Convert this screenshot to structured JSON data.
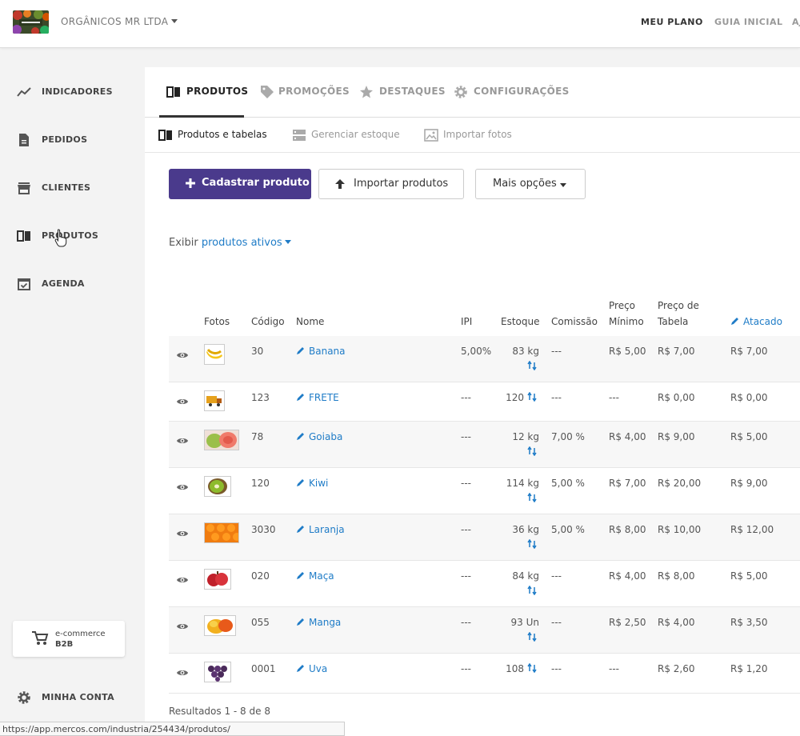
{
  "header": {
    "company": "ORGÂNICOS MR LTDA",
    "nav": [
      "MEU PLANO",
      "GUIA INICIAL",
      "AJUDA"
    ]
  },
  "sidebar": {
    "items": [
      {
        "label": "INDICADORES",
        "icon": "trending-up-icon"
      },
      {
        "label": "PEDIDOS",
        "icon": "document-icon"
      },
      {
        "label": "CLIENTES",
        "icon": "store-icon"
      },
      {
        "label": "PRODUTOS",
        "icon": "book-icon"
      },
      {
        "label": "AGENDA",
        "icon": "calendar-check-icon"
      }
    ],
    "ecommerce": {
      "line1": "e-commerce",
      "line2": "B2B"
    },
    "account": "MINHA CONTA"
  },
  "tabs": [
    "PRODUTOS",
    "PROMOÇÕES",
    "DESTAQUES",
    "CONFIGURAÇÕES"
  ],
  "subtabs": [
    "Produtos e tabelas",
    "Gerenciar estoque",
    "Importar fotos"
  ],
  "actions": {
    "primary": "Cadastrar produto",
    "import": "Importar produtos",
    "more": "Mais opções"
  },
  "filter": {
    "prefix": "Exibir",
    "value": "produtos ativos"
  },
  "table": {
    "headers": {
      "photos": "Fotos",
      "code": "Código",
      "name": "Nome",
      "ipi": "IPI",
      "stock": "Estoque",
      "commission": "Comissão",
      "min_price_1": "Preço",
      "min_price_2": "Mínimo",
      "table_price_1": "Preço de",
      "table_price_2": "Tabela",
      "wholesale": "Atacado"
    },
    "rows": [
      {
        "code": "30",
        "name": "Banana",
        "ipi": "5,00%",
        "stock": "83 kg",
        "commission": "---",
        "min": "R$ 5,00",
        "table": "R$ 7,00",
        "wholesale": "R$ 7,00",
        "fruit": "banana"
      },
      {
        "code": "123",
        "name": "FRETE",
        "ipi": "---",
        "stock": "120",
        "commission": "---",
        "min": "---",
        "table": "R$ 0,00",
        "wholesale": "R$ 0,00",
        "fruit": "truck"
      },
      {
        "code": "78",
        "name": "Goiaba",
        "ipi": "---",
        "stock": "12 kg",
        "commission": "7,00 %",
        "min": "R$ 4,00",
        "table": "R$ 9,00",
        "wholesale": "R$ 5,00",
        "fruit": "guava"
      },
      {
        "code": "120",
        "name": "Kiwi",
        "ipi": "---",
        "stock": "114 kg",
        "commission": "5,00 %",
        "min": "R$ 7,00",
        "table": "R$ 20,00",
        "wholesale": "R$ 9,00",
        "fruit": "kiwi"
      },
      {
        "code": "3030",
        "name": "Laranja",
        "ipi": "---",
        "stock": "36 kg",
        "commission": "5,00 %",
        "min": "R$ 8,00",
        "table": "R$ 10,00",
        "wholesale": "R$ 12,00",
        "fruit": "orange"
      },
      {
        "code": "020",
        "name": "Maça",
        "ipi": "---",
        "stock": "84 kg",
        "commission": "---",
        "min": "R$ 4,00",
        "table": "R$ 8,00",
        "wholesale": "R$ 5,00",
        "fruit": "apple"
      },
      {
        "code": "055",
        "name": "Manga",
        "ipi": "---",
        "stock": "93 Un",
        "commission": "---",
        "min": "R$ 2,50",
        "table": "R$ 4,00",
        "wholesale": "R$ 3,50",
        "fruit": "mango"
      },
      {
        "code": "0001",
        "name": "Uva",
        "ipi": "---",
        "stock": "108",
        "commission": "---",
        "min": "---",
        "table": "R$ 2,60",
        "wholesale": "R$ 1,20",
        "fruit": "grape"
      }
    ]
  },
  "results": "Resultados 1 - 8 de 8",
  "status_url": "https://app.mercos.com/industria/254434/produtos/",
  "colors": {
    "primary": "#4a3a8c",
    "link": "#1f7cc7"
  }
}
